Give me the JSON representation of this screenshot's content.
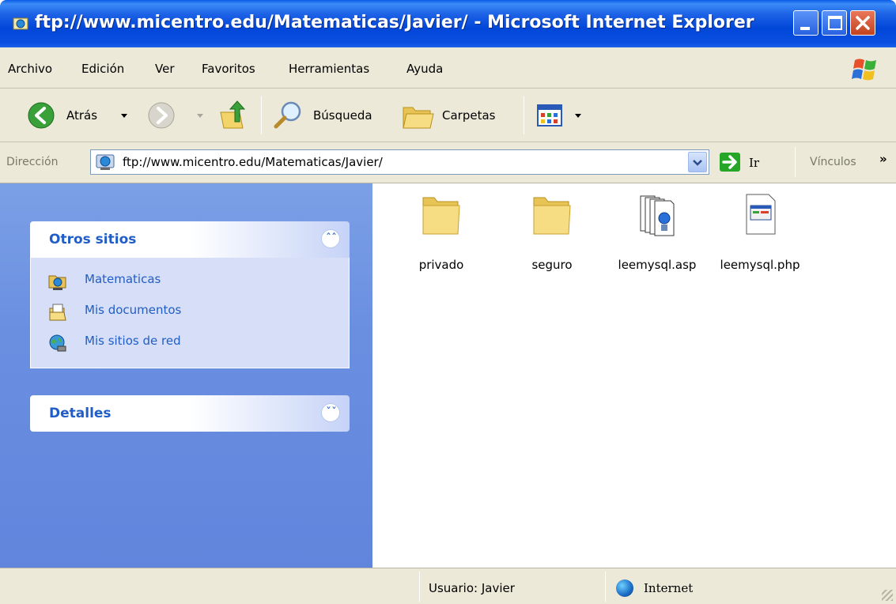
{
  "window": {
    "title": "ftp://www.micentro.edu/Matematicas/Javier/ - Microsoft Internet Explorer"
  },
  "menu": [
    "Archivo",
    "Edición",
    "Ver",
    "Favoritos",
    "Herramientas",
    "Ayuda"
  ],
  "toolbar": {
    "back_label": "Atrás",
    "search_label": "Búsqueda",
    "folders_label": "Carpetas"
  },
  "address": {
    "label": "Dirección",
    "value": "ftp://www.micentro.edu/Matematicas/Javier/",
    "go_label": "Ir",
    "links_label": "Vínculos",
    "more": "»"
  },
  "sidebar": {
    "other_places": {
      "title": "Otros sitios",
      "items": [
        {
          "label": "Matematicas",
          "icon": "ftp-folder-icon"
        },
        {
          "label": "Mis documentos",
          "icon": "my-documents-icon"
        },
        {
          "label": "Mis sitios de red",
          "icon": "network-places-icon"
        }
      ]
    },
    "details": {
      "title": "Detalles"
    }
  },
  "files": [
    {
      "name": "privado",
      "icon": "folder-icon"
    },
    {
      "name": "seguro",
      "icon": "folder-icon"
    },
    {
      "name": "leemysql.asp",
      "icon": "asp-file-icon"
    },
    {
      "name": "leemysql.php",
      "icon": "php-file-icon"
    }
  ],
  "status": {
    "user": "Usuario: Javier",
    "zone": "Internet"
  },
  "colors": {
    "titlebar": "#0046d8",
    "sidebar": "#6a8ee0",
    "panel_title": "#215dc6",
    "chrome": "#ece9d8"
  }
}
